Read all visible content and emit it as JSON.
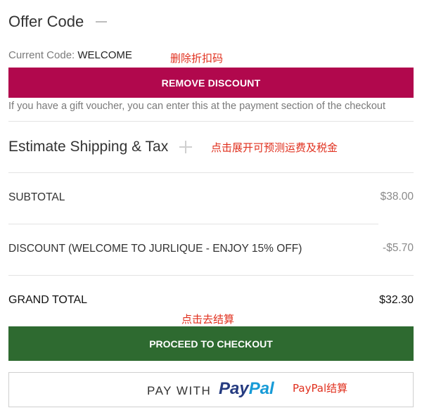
{
  "offer": {
    "title": "Offer Code",
    "current_code_label": "Current Code:",
    "current_code_value": "WELCOME",
    "remove_button": "REMOVE DISCOUNT",
    "voucher_note": "If you have a gift voucher, you can enter this at the payment section of the checkout"
  },
  "shipping": {
    "title": "Estimate Shipping & Tax"
  },
  "totals": {
    "subtotal_label": "SUBTOTAL",
    "subtotal_value": "$38.00",
    "discount_label": "DISCOUNT (WELCOME TO JURLIQUE - ENJOY 15% OFF)",
    "discount_value": "-$5.70",
    "grand_total_label": "GRAND TOTAL",
    "grand_total_value": "$32.30"
  },
  "actions": {
    "checkout_button": "PROCEED TO CHECKOUT",
    "paypal_prefix": "PAY WITH",
    "paypal_logo_part1": "Pay",
    "paypal_logo_part2": "Pal"
  },
  "annotations": {
    "remove_code": "删除折扣码",
    "expand_shipping": "点击展开可预测运费及税金",
    "go_checkout": "点击去结算",
    "paypal_checkout": "PayPal结算"
  },
  "colors": {
    "remove_button_bg": "#b1084d",
    "checkout_button_bg": "#2e6a30",
    "annotation_text": "#e0301e",
    "paypal_dark": "#253b80",
    "paypal_light": "#179bd7"
  },
  "icons": {
    "offer_toggle": "minus-icon",
    "shipping_toggle": "plus-icon"
  }
}
